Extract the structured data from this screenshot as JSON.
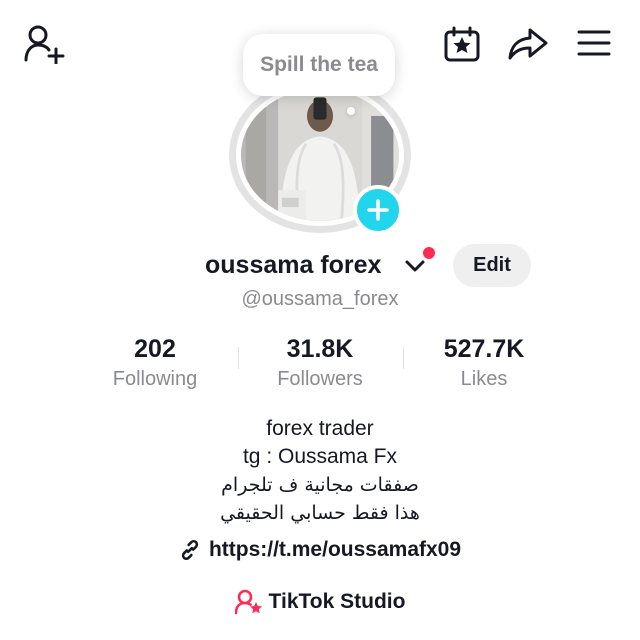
{
  "header": {
    "icons": {
      "add_friend": "add-user-icon",
      "calendar": "calendar-star-icon",
      "share": "share-icon",
      "menu": "menu-icon"
    }
  },
  "note_bubble": {
    "text": "Spill the tea"
  },
  "profile": {
    "display_name": "oussama forex",
    "handle": "@oussama_forex",
    "edit_label": "Edit"
  },
  "stats": [
    {
      "value": "202",
      "label": "Following"
    },
    {
      "value": "31.8K",
      "label": "Followers"
    },
    {
      "value": "527.7K",
      "label": "Likes"
    }
  ],
  "bio": {
    "lines": [
      "forex trader",
      "tg : Oussama Fx",
      "صفقات مجانية ف تلجرام",
      "هذا فقط حسابي الحقيقي"
    ],
    "link": "https://t.me/oussamafx09"
  },
  "studio": {
    "label": "TikTok Studio"
  },
  "colors": {
    "accent_cyan": "#20d5ec",
    "notification_red": "#fe2c55",
    "muted_text": "#8a8b91",
    "primary_text": "#161823",
    "studio_pink": "#fe2c55"
  }
}
